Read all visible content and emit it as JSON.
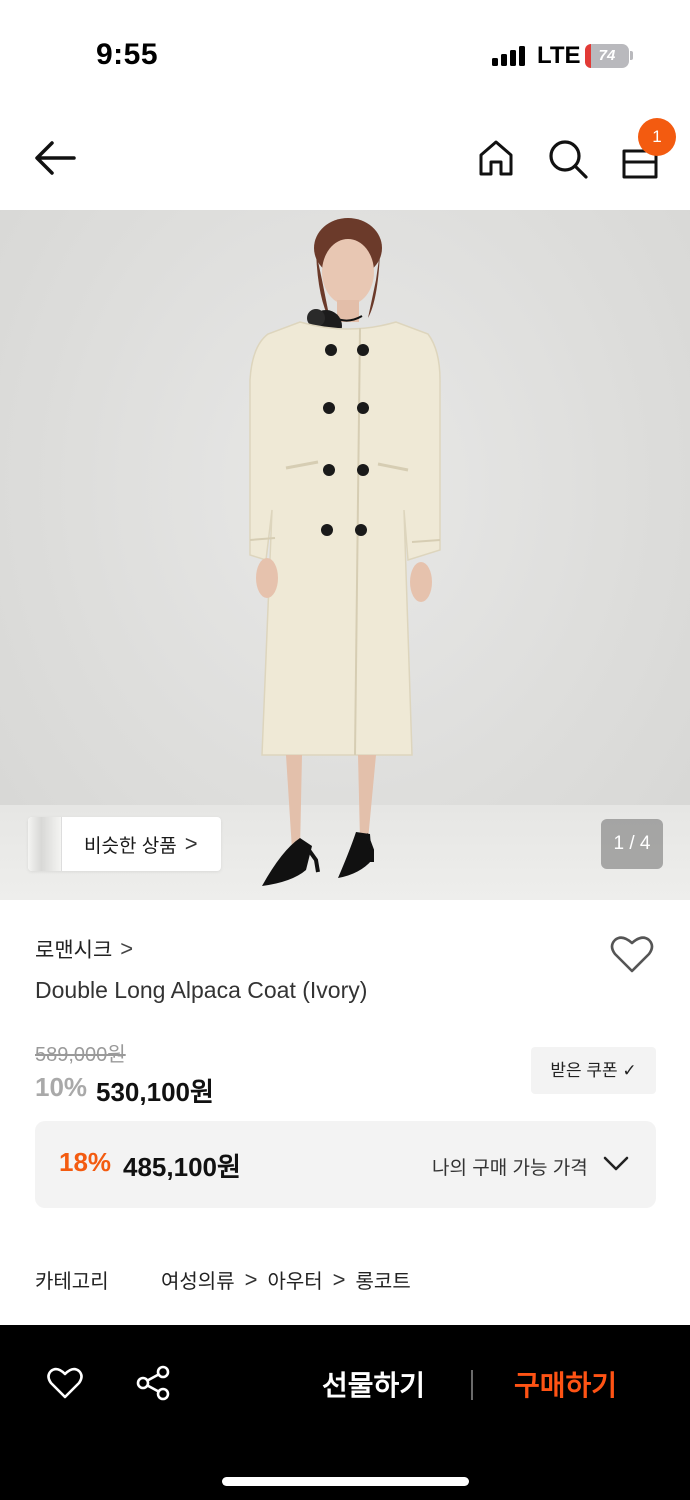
{
  "status_bar": {
    "time": "9:55",
    "network": "LTE",
    "battery": "74",
    "icons": [
      "signal-icon",
      "battery-icon"
    ]
  },
  "nav": {
    "icons": [
      "back-arrow-icon",
      "home-icon",
      "search-icon",
      "shopping-bag-icon"
    ],
    "cart_count": "1",
    "accent_color": "#f35b10"
  },
  "gallery": {
    "similar_label": "비슷한 상품",
    "similar_chevron": ">",
    "page_indicator": "1 / 4"
  },
  "product": {
    "brand": "로맨시크",
    "brand_chevron": ">",
    "title": "Double Long Alpaca Coat (Ivory)",
    "original_price": "589,000원",
    "discount_rate": "10%",
    "sale_price": "530,100원",
    "coupon_label": "받은 쿠폰 ✓",
    "my_price": {
      "rate": "18%",
      "price": "485,100원",
      "label": "나의 구매 가능 가격"
    },
    "category": {
      "label": "카테고리",
      "path": [
        "여성의류",
        "아우터",
        "롱코트"
      ],
      "separator": ">"
    }
  },
  "bottom_bar": {
    "gift_label": "선물하기",
    "buy_label": "구매하기",
    "buy_color": "#ff5314",
    "icons": [
      "heart-icon",
      "share-icon"
    ]
  }
}
